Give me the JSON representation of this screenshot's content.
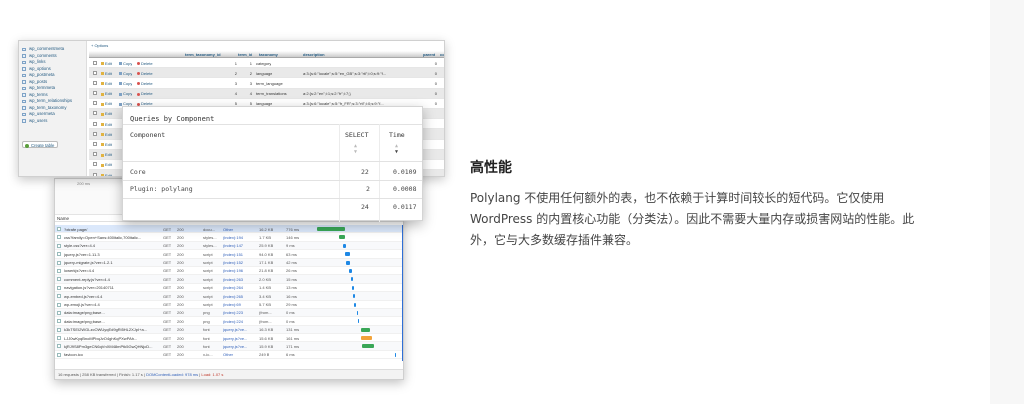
{
  "feature": {
    "title": "高性能",
    "line1": "Polylang 不使用任何额外的表，也不依赖于计算时间较长的短代码。它仅使用",
    "line2": "WordPress 的内置核心功能（分类法）。因此不需要大量内存或损害网站的性能。此",
    "line3": "外，它与大多数缓存插件兼容。"
  },
  "pma": {
    "options_label": "+ Options",
    "sidebar_tables": [
      "wp_commentmeta",
      "wp_comments",
      "wp_links",
      "wp_options",
      "wp_postmeta",
      "wp_posts",
      "wp_termmeta",
      "wp_terms",
      "wp_term_relationships",
      "wp_term_taxonomy",
      "wp_usermeta",
      "wp_users"
    ],
    "create_table_label": "Create table",
    "columns": [
      "term_taxonomy_id",
      "term_id",
      "taxonomy",
      "description",
      "parent",
      "count"
    ],
    "edit_label": "Edit",
    "copy_label": "Copy",
    "delete_label": "Delete",
    "rows": [
      {
        "tt_id": "1",
        "term_id": "1",
        "taxonomy": "category",
        "description": "",
        "parent": "0",
        "count": "0"
      },
      {
        "tt_id": "2",
        "term_id": "2",
        "taxonomy": "language",
        "description": "a:3:{s:6:\"locale\";s:5:\"en_GB\";s:3:\"rtl\";i:0;s:9:\"f...",
        "parent": "0",
        "count": "0"
      },
      {
        "tt_id": "3",
        "term_id": "3",
        "taxonomy": "term_language",
        "description": "",
        "parent": "0",
        "count": "0"
      },
      {
        "tt_id": "4",
        "term_id": "4",
        "taxonomy": "term_translations",
        "description": "a:2:{s:2:\"en\";i:1;s:2:\"fr\";i:7;}",
        "parent": "0",
        "count": "1"
      },
      {
        "tt_id": "5",
        "term_id": "5",
        "taxonomy": "language",
        "description": "a:3:{s:6:\"locale\";s:5:\"fr_FR\";s:3:\"rtl\";i:0;s:9:\"f...",
        "parent": "0",
        "count": "0"
      }
    ],
    "extra_row_count": 7
  },
  "qbc": {
    "title": "Queries by Component",
    "col_component": "Component",
    "col_select": "SELECT",
    "col_time": "Time",
    "rows": [
      {
        "component": "Core",
        "select": "22",
        "time": "0.0109"
      },
      {
        "component": "Plugin: polylang",
        "select": "2",
        "time": "0.0008"
      }
    ],
    "total": {
      "select": "24",
      "time": "0.0117"
    }
  },
  "net": {
    "name_header": "Name",
    "timeline_ticks": [
      "200 ms",
      "400 ms"
    ],
    "rows": [
      {
        "name": "?xtrafe page/",
        "method": "GET",
        "status": "200",
        "type": "docu...",
        "initiator": "Other",
        "size": "16.2 KB",
        "time": "776 ms"
      },
      {
        "name": "css?family=Open+Sans:400italic,700italic...",
        "method": "GET",
        "status": "200",
        "type": "styles...",
        "initiator": "(index):194",
        "size": "1.7 KB",
        "time": "146 ms"
      },
      {
        "name": "style.css?ver=4.4",
        "method": "GET",
        "status": "200",
        "type": "styles...",
        "initiator": "(index):147",
        "size": "25.9 KB",
        "time": "9 ms"
      },
      {
        "name": "jquery.js?ver=1.11.3",
        "method": "GET",
        "status": "200",
        "type": "script",
        "initiator": "(index):151",
        "size": "94.0 KB",
        "time": "63 ms"
      },
      {
        "name": "jquery-migrate.js?ver=1.2.1",
        "method": "GET",
        "status": "200",
        "type": "script",
        "initiator": "(index):152",
        "size": "17.1 KB",
        "time": "42 ms"
      },
      {
        "name": "lowerkjs?ver=4.4",
        "method": "GET",
        "status": "200",
        "type": "script",
        "initiator": "(index):196",
        "size": "21.8 KB",
        "time": "26 ms"
      },
      {
        "name": "comment-reply.js?ver=4.4",
        "method": "GET",
        "status": "200",
        "type": "script",
        "initiator": "(index):263",
        "size": "2.0 KB",
        "time": "15 ms"
      },
      {
        "name": "navigation.js?ver=20140711",
        "method": "GET",
        "status": "200",
        "type": "script",
        "initiator": "(index):264",
        "size": "1.4 KB",
        "time": "13 ms"
      },
      {
        "name": "wp-embed.js?ver=4.4",
        "method": "GET",
        "status": "200",
        "type": "script",
        "initiator": "(index):265",
        "size": "3.4 KB",
        "time": "16 ms"
      },
      {
        "name": "wp-emoji.js?ver=4.4",
        "method": "GET",
        "status": "200",
        "type": "script",
        "initiator": "(index):69",
        "size": "5.7 KB",
        "time": "29 ms"
      },
      {
        "name": "data:image/png;base...",
        "method": "GET",
        "status": "200",
        "type": "png",
        "initiator": "(index):223",
        "size": "(from...",
        "time": "0 ms"
      },
      {
        "name": "data:image/png;base...",
        "method": "GET",
        "status": "200",
        "type": "png",
        "initiator": "(index):224",
        "size": "(from...",
        "time": "0 ms"
      },
      {
        "name": "k3kTSEI2WGLzcOWUyqEd9gRi5HL2XJpI+a...",
        "method": "GET",
        "status": "200",
        "type": "font",
        "initiator": "jquery.js?ve...",
        "size": "16.3 KB",
        "time": "131 ms"
      },
      {
        "name": "LJJ0wKyqBnoMPbqJvO4ghKqPXwPAh...",
        "method": "GET",
        "status": "200",
        "type": "font",
        "initiator": "jquery.js?ve...",
        "size": "15.6 KB",
        "time": "161 ms"
      },
      {
        "name": "kjRJ9S8Pm3geCN6qVnXM48mPtk5GwQHNjcD...",
        "method": "GET",
        "status": "200",
        "type": "font",
        "initiator": "jquery.js?ve...",
        "size": "15.9 KB",
        "time": "171 ms"
      },
      {
        "name": "favicon.ico",
        "method": "GET",
        "status": "200",
        "type": "x-ic...",
        "initiator": "Other",
        "size": "249 B",
        "time": "6 ms"
      }
    ],
    "footer": {
      "requests": "16 requests",
      "transferred": "258 KB transferred",
      "finish": "Finish: 1.17 s",
      "dcl": "DOMContentLoaded: 978 ms",
      "load": "Load: 1.07 s"
    },
    "colors": {
      "bar_green": "#3aa757",
      "bar_blue": "#1e88e5",
      "bar_orange": "#f2a33a",
      "dcl_line": "#2f6fd6",
      "load_line": "#d23a2a"
    }
  }
}
